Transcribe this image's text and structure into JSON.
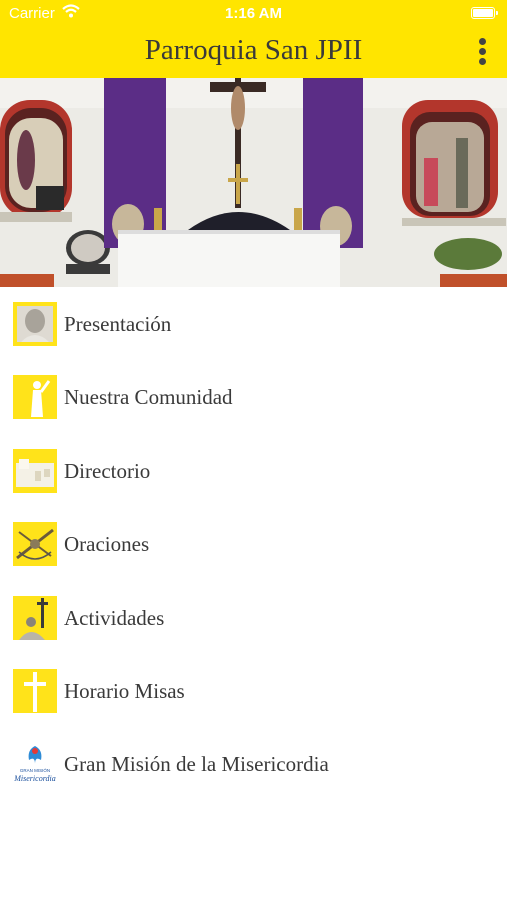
{
  "status_bar": {
    "carrier": "Carrier",
    "time": "1:16 AM"
  },
  "app_bar": {
    "title": "Parroquia San JPII",
    "menu_icon": "more-vertical-icon"
  },
  "colors": {
    "brand_yellow": "#ffe500",
    "text": "#3a3a3a",
    "purple_drape": "#5b2d86"
  },
  "menu": [
    {
      "label": "Presentación",
      "icon": "pope-portrait-icon"
    },
    {
      "label": "Nuestra Comunidad",
      "icon": "statue-icon"
    },
    {
      "label": "Directorio",
      "icon": "building-icon"
    },
    {
      "label": "Oraciones",
      "icon": "rosary-icon"
    },
    {
      "label": "Actividades",
      "icon": "pope-cross-icon"
    },
    {
      "label": "Horario Misas",
      "icon": "cross-icon"
    },
    {
      "label": "Gran Misión de la Misericordia",
      "icon": "mission-logo-icon",
      "logo_text": [
        "GRAN MISIÓN",
        "Misericordia"
      ]
    }
  ]
}
